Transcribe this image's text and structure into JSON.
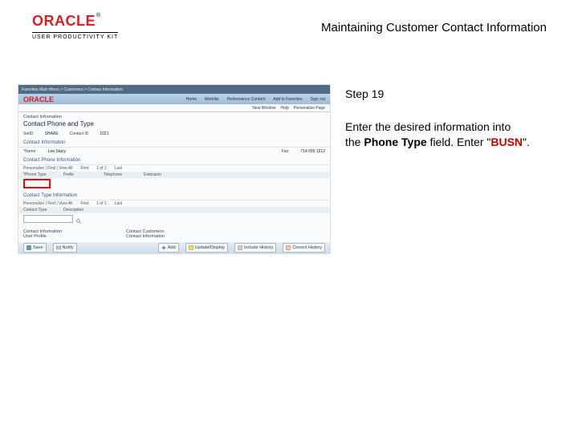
{
  "header": {
    "brand_main": "ORACLE",
    "brand_tm": "®",
    "brand_sub": "USER PRODUCTIVITY KIT",
    "title": "Maintaining Customer Contact Information"
  },
  "instruction": {
    "step_label": "Step 19",
    "line1": "Enter the desired information into",
    "line2a": "the ",
    "field_name": "Phone Type",
    "line2b": " field. Enter \"",
    "value": "BUSN",
    "line2c": "\"."
  },
  "screenshot": {
    "breadcrumb": "Favorites    Main Menu > Customers > Contact Information",
    "brand": "ORACLE",
    "nav": {
      "home": "Home",
      "worklist": "Worklist",
      "pc": "Performance Content",
      "addfav": "Add to Favorites",
      "signout": "Sign out"
    },
    "subnav": {
      "newwin": "New Window",
      "help": "Help",
      "personalize": "Personalize Page"
    },
    "page_bc": "Contact Information",
    "page_title": "Contact Phone and Type",
    "info1": {
      "setid_l": "SetID",
      "setid_v": "SHARE",
      "cid_l": "Contact ID",
      "cid_v": "1021"
    },
    "section1": "Contact Information",
    "row1": {
      "name_l": "*Name:",
      "name_v": "Lee,Stacy",
      "fax_l": "Fax:",
      "fax_v": "714 555 1212"
    },
    "section2": "Contact Phone Information",
    "row2": {
      "pers": "Personalize | Find | View All",
      "first": "First",
      "rc": "1 of 1",
      "last": "Last"
    },
    "gridhead": {
      "c1": "*Phone Type",
      "c2": "Prefix",
      "c3": "Telephone",
      "c4": "Extension"
    },
    "gridrow": {
      "c2": "",
      "c3": "",
      "c4": ""
    },
    "section3": "Contact Type Information",
    "row3": {
      "pers": "Personalize | Find | View All",
      "first": "First",
      "rc": "1 of 1",
      "last": "Last"
    },
    "gridhead2": {
      "c1": "Contact Type",
      "c2": "Description"
    },
    "links": {
      "l1": "Contact Information",
      "l2": "Contact Customers",
      "l3": "User Profile",
      "l4": "Contact Information"
    },
    "footer": {
      "save": "Save",
      "notify": "Notify",
      "add": "Add",
      "update": "Update/Display",
      "history": "Include History",
      "correct": "Correct History"
    }
  }
}
